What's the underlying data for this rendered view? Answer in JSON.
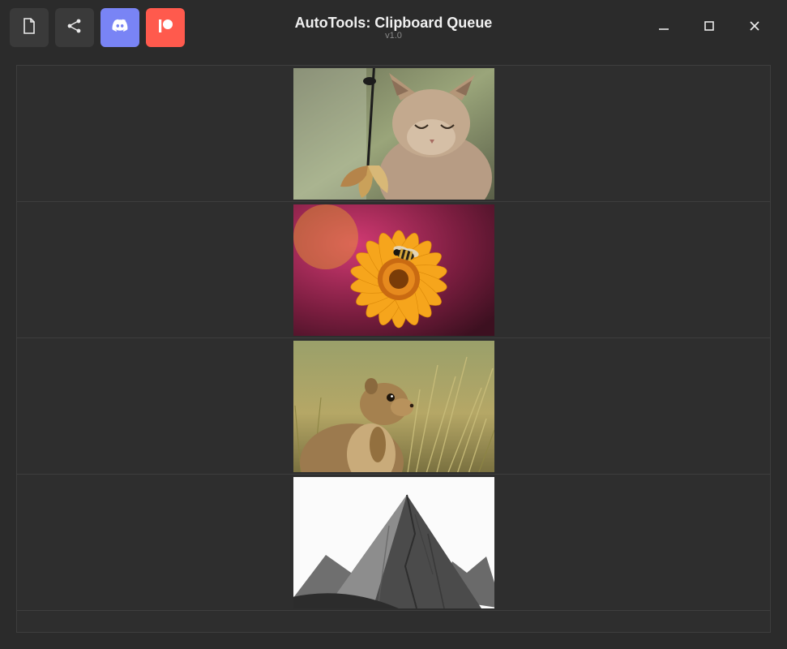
{
  "header": {
    "title": "AutoTools: Clipboard Queue",
    "version": "v1.0"
  },
  "toolbar": {
    "buttons": [
      {
        "name": "new-file-button",
        "icon": "file-icon",
        "style": "plain"
      },
      {
        "name": "share-button",
        "icon": "share-icon",
        "style": "plain"
      },
      {
        "name": "discord-button",
        "icon": "discord-icon",
        "style": "discord"
      },
      {
        "name": "patreon-button",
        "icon": "patreon-icon",
        "style": "patreon"
      }
    ],
    "settings_name": "settings-button"
  },
  "window_controls": {
    "minimize_name": "minimize-button",
    "maximize_name": "maximize-button",
    "close_name": "close-button"
  },
  "queue": {
    "items": [
      {
        "name": "queue-item-1",
        "thumb_desc": "cat-with-toy"
      },
      {
        "name": "queue-item-2",
        "thumb_desc": "bee-on-orange-flower"
      },
      {
        "name": "queue-item-3",
        "thumb_desc": "ground-squirrel-in-grass"
      },
      {
        "name": "queue-item-4",
        "thumb_desc": "mountain-grayscale"
      }
    ]
  },
  "colors": {
    "bg": "#2b2b2b",
    "panel": "#2e2e2e",
    "border": "#3e3e3e",
    "discord": "#7984f5",
    "patreon": "#ff5a4d"
  }
}
